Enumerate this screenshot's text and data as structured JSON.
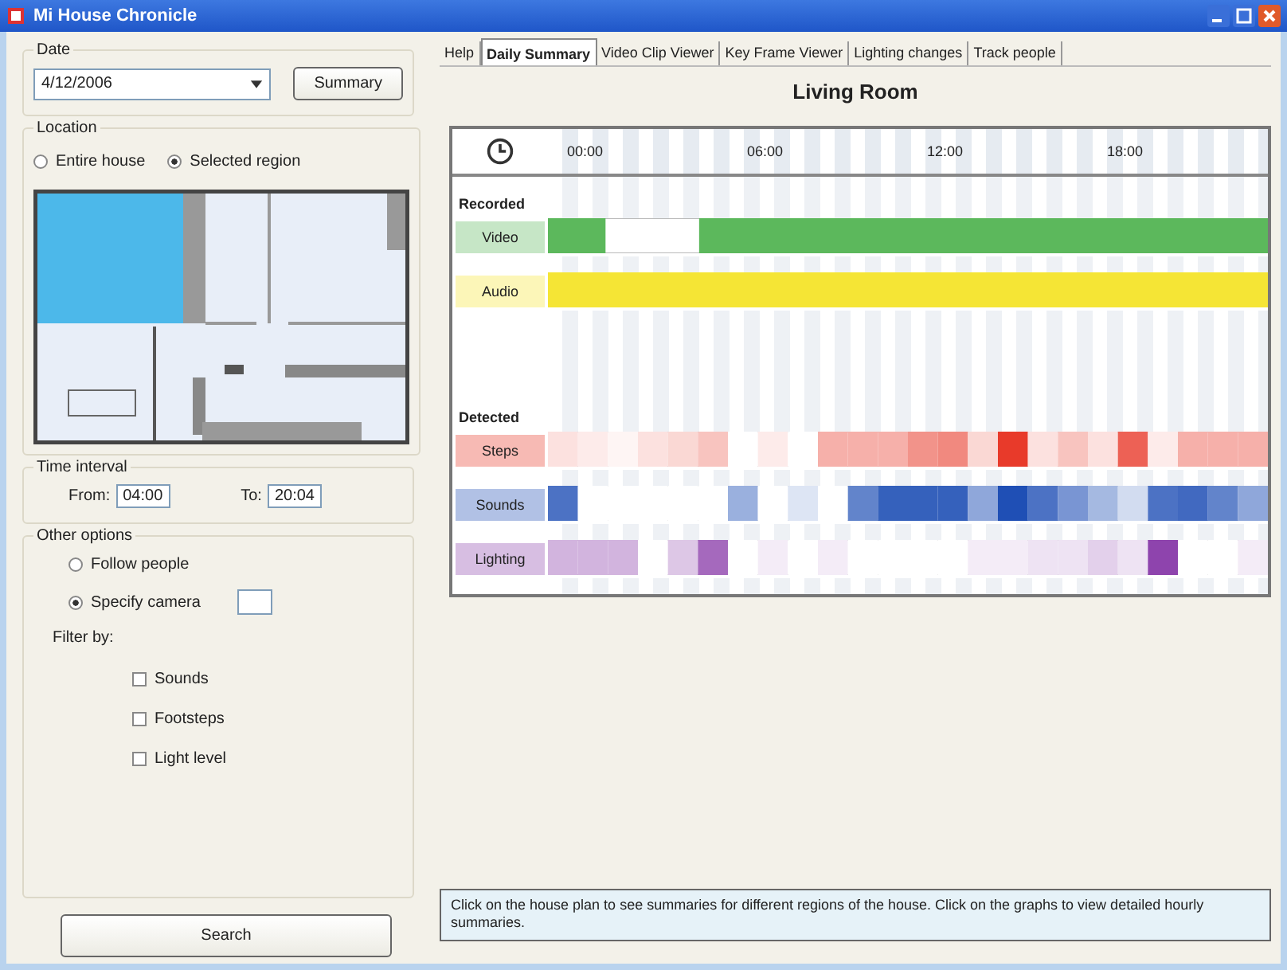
{
  "window": {
    "title": "Mi House Chronicle"
  },
  "date": {
    "label": "Date",
    "value": "4/12/2006",
    "button": "Summary"
  },
  "location": {
    "label": "Location",
    "options": [
      {
        "label": "Entire house",
        "selected": false
      },
      {
        "label": "Selected region",
        "selected": true
      }
    ]
  },
  "time_interval": {
    "label": "Time interval",
    "from_label": "From:",
    "from": "04:00",
    "to_label": "To:",
    "to": "20:04"
  },
  "other_options": {
    "label": "Other options",
    "options": [
      {
        "label": "Follow people",
        "selected": false
      },
      {
        "label": "Specify camera",
        "selected": true
      }
    ],
    "filter_label": "Filter by:",
    "filters": [
      {
        "label": "Sounds",
        "checked": false
      },
      {
        "label": "Footsteps",
        "checked": false
      },
      {
        "label": "Light level",
        "checked": false
      }
    ]
  },
  "search_button": "Search",
  "tabs": [
    {
      "label": "Help",
      "selected": false
    },
    {
      "label": "Daily Summary",
      "selected": true
    },
    {
      "label": "Video Clip Viewer",
      "selected": false
    },
    {
      "label": "Key Frame Viewer",
      "selected": false
    },
    {
      "label": "Lighting changes",
      "selected": false
    },
    {
      "label": "Track people",
      "selected": false
    }
  ],
  "room_title": "Living Room",
  "timeline": {
    "hours": [
      "00:00",
      "06:00",
      "12:00",
      "18:00"
    ],
    "recorded_label": "Recorded",
    "recorded": [
      {
        "name": "Video",
        "color": "#5cb85c"
      },
      {
        "name": "Audio",
        "color": "#f5e535"
      }
    ],
    "detected_label": "Detected",
    "detected": [
      {
        "name": "Steps",
        "color": "#e83a2a"
      },
      {
        "name": "Sounds",
        "color": "#1f4fb5"
      },
      {
        "name": "Lighting",
        "color": "#8e44ad"
      }
    ]
  },
  "hint": "Click on the house plan to see summaries for different regions of the house. Click on the graphs to view detailed hourly summaries."
}
